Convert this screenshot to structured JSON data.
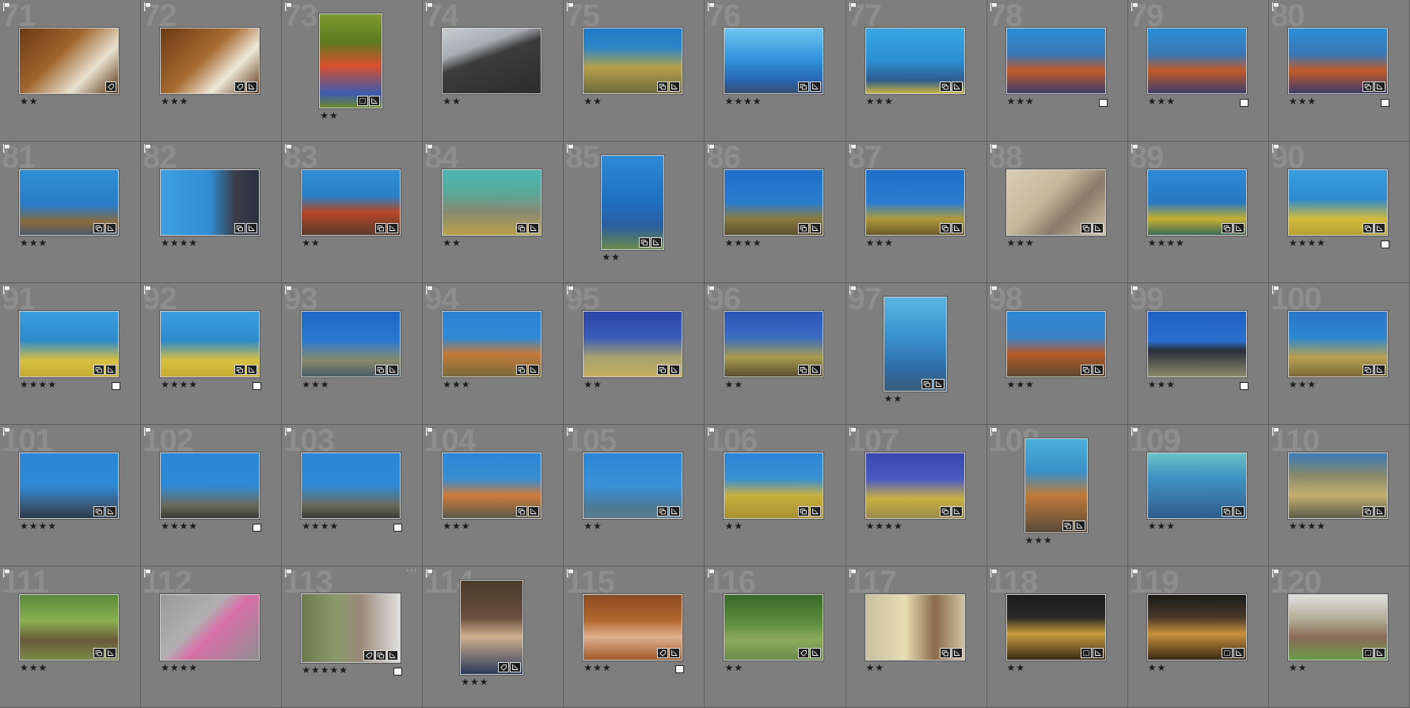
{
  "grid": {
    "cells": [
      {
        "index": "71",
        "stars": "★★",
        "shape": "land",
        "bg": "linear-gradient(135deg,#6b3a14 0%,#a0652d 40%,#e9e2d0 70%,#5a3412 100%)",
        "badges": [
          "keyword-icon"
        ]
      },
      {
        "index": "72",
        "stars": "★★★",
        "shape": "land",
        "bg": "linear-gradient(135deg,#6b3a14 0%,#a86b30 45%,#efe8d8 70%,#5a3412 100%)",
        "badges": [
          "keyword-icon",
          "crop-icon"
        ]
      },
      {
        "index": "73",
        "stars": "★★",
        "shape": "port",
        "bg": "linear-gradient(180deg,#7d9a30 0%,#5d7a20 30%,#d8502c 55%,#3a5bb0 85%,#6b8a2a 100%)",
        "badges": [
          "grid-icon",
          "crop-icon"
        ]
      },
      {
        "index": "74",
        "stars": "★★",
        "shape": "land",
        "bg": "linear-gradient(160deg,#c9cccf 0%,#a9adb1 30%,#3c3c3c 45%,#2c2c2c 100%)",
        "badges": []
      },
      {
        "index": "75",
        "stars": "★★",
        "shape": "land",
        "bg": "linear-gradient(180deg,#1f7ac9 0%,#2d86c4 30%,#b5a14a 60%,#6e6a3d 100%)",
        "badges": [
          "stack-icon",
          "crop-icon"
        ]
      },
      {
        "index": "76",
        "stars": "★★★★",
        "shape": "land",
        "bg": "linear-gradient(180deg,#6cc6f0 0%,#2f8fd8 50%,#2866b0 80%,#3a4e6e 100%)",
        "badges": [
          "stack-icon",
          "crop-icon"
        ]
      },
      {
        "index": "77",
        "stars": "★★★",
        "shape": "land",
        "bg": "linear-gradient(180deg,#38a7e2 0%,#2b8fd3 50%,#2e5b8e 80%,#c8b540 100%)",
        "badges": [
          "stack-icon",
          "crop-icon"
        ]
      },
      {
        "index": "78",
        "stars": "★★★",
        "shape": "land",
        "bg": "linear-gradient(180deg,#2a8ed6 0%,#3a78b5 40%,#c25a28 65%,#3c3c6a 100%)",
        "badges": [],
        "check": true
      },
      {
        "index": "79",
        "stars": "★★★",
        "shape": "land",
        "bg": "linear-gradient(180deg,#2a8ed6 0%,#3a78b5 40%,#c25a28 65%,#3c3c6a 100%)",
        "badges": [],
        "check": true
      },
      {
        "index": "80",
        "stars": "★★★",
        "shape": "land",
        "bg": "linear-gradient(180deg,#2a8ed6 0%,#3a78b5 40%,#c25a28 65%,#3c3c6a 100%)",
        "badges": [
          "stack-icon",
          "crop-icon"
        ],
        "check": true
      },
      {
        "index": "81",
        "stars": "★★★",
        "shape": "land",
        "bg": "linear-gradient(180deg,#2d8fd6 0%,#2a7cc4 55%,#8a6a3a 80%,#4c5a6c 100%)",
        "badges": [
          "stack-icon",
          "crop-icon"
        ]
      },
      {
        "index": "82",
        "stars": "★★★★",
        "shape": "land",
        "bg": "linear-gradient(90deg,#3ea0e0 0%,#2f8cd4 50%,#3a3e48 75%,#2a3040 100%)",
        "badges": [
          "stack-icon",
          "crop-icon"
        ]
      },
      {
        "index": "83",
        "stars": "★★",
        "shape": "land",
        "bg": "linear-gradient(180deg,#2f8fd6 0%,#2a7fc8 40%,#b6472a 65%,#5a3a2a 100%)",
        "badges": [
          "stack-icon",
          "crop-icon"
        ]
      },
      {
        "index": "84",
        "stars": "★★",
        "shape": "land",
        "bg": "linear-gradient(180deg,#49b6b0 0%,#5aa89a 35%,#8a8a72 65%,#b8a24a 100%)",
        "badges": [
          "stack-icon",
          "crop-icon"
        ]
      },
      {
        "index": "85",
        "stars": "★★",
        "shape": "port",
        "bg": "linear-gradient(180deg,#2d8ad6 0%,#1f6fbf 50%,#2a5ea0 75%,#6a8a4a 100%)",
        "badges": [
          "stack-icon",
          "crop-icon"
        ]
      },
      {
        "index": "86",
        "stars": "★★★★",
        "shape": "land",
        "bg": "linear-gradient(180deg,#1f6fc8 0%,#2a7cd0 50%,#8a7a40 75%,#5c5230 100%)",
        "badges": [
          "stack-icon",
          "crop-icon"
        ]
      },
      {
        "index": "87",
        "stars": "★★★",
        "shape": "land",
        "bg": "linear-gradient(180deg,#1f6fc8 0%,#2a7cd0 50%,#b09a3c 75%,#6a5a2a 100%)",
        "badges": [
          "stack-icon",
          "crop-icon"
        ]
      },
      {
        "index": "88",
        "stars": "★★★",
        "shape": "land",
        "bg": "linear-gradient(135deg,#d8cdb5 0%,#c6b89a 40%,#8a7a6a 65%,#d2c5a8 100%)",
        "badges": [
          "stack-icon",
          "crop-icon"
        ]
      },
      {
        "index": "89",
        "stars": "★★★★",
        "shape": "land",
        "bg": "linear-gradient(180deg,#2d8ad6 0%,#2778c2 50%,#c5b030 75%,#3a6a5a 100%)",
        "badges": [
          "stack-icon",
          "crop-icon"
        ]
      },
      {
        "index": "90",
        "stars": "★★★★",
        "shape": "land",
        "bg": "linear-gradient(180deg,#3a9ee0 0%,#2e8ad0 45%,#d2bc3c 75%,#b8a030 100%)",
        "badges": [
          "stack-icon",
          "crop-icon"
        ],
        "check": true
      },
      {
        "index": "91",
        "stars": "★★★★",
        "shape": "land",
        "bg": "linear-gradient(180deg,#3a9ee0 0%,#2f8acb 45%,#d8c040 75%,#c4ac30 100%)",
        "badges": [
          "stack-icon",
          "crop-icon"
        ],
        "check": true
      },
      {
        "index": "92",
        "stars": "★★★★",
        "shape": "land",
        "bg": "linear-gradient(180deg,#3a9ee0 0%,#2f8acb 45%,#d8c040 75%,#c4ac30 100%)",
        "badges": [
          "stack-icon",
          "crop-icon"
        ],
        "check": true
      },
      {
        "index": "93",
        "stars": "★★★",
        "shape": "land",
        "bg": "linear-gradient(180deg,#2066c4 0%,#2a7ad0 45%,#8a8a6a 75%,#4a5c6a 100%)",
        "badges": [
          "stack-icon",
          "crop-icon"
        ]
      },
      {
        "index": "94",
        "stars": "★★★",
        "shape": "land",
        "bg": "linear-gradient(180deg,#2a82d0 0%,#2f8ad6 40%,#c47a3a 65%,#7a6a3a 100%)",
        "badges": [
          "stack-icon",
          "crop-icon"
        ]
      },
      {
        "index": "95",
        "stars": "★★",
        "shape": "land",
        "bg": "linear-gradient(180deg,#2a46a8 0%,#3a5cb8 40%,#a8a070 70%,#c4b060 100%)",
        "badges": [
          "stack-icon",
          "crop-icon"
        ]
      },
      {
        "index": "96",
        "stars": "★★",
        "shape": "land",
        "bg": "linear-gradient(180deg,#2a56b8 0%,#3a6cc0 40%,#a89a50 70%,#5a5030 100%)",
        "badges": [
          "stack-icon",
          "crop-icon"
        ]
      },
      {
        "index": "97",
        "stars": "★★",
        "shape": "port",
        "bg": "linear-gradient(180deg,#5ab6e0 0%,#3a94cf 40%,#2e6ea8 75%,#3a5c7a 100%)",
        "badges": [
          "stack-icon",
          "crop-icon"
        ]
      },
      {
        "index": "98",
        "stars": "★★★",
        "shape": "land",
        "bg": "linear-gradient(180deg,#2a86d2 0%,#3a84c4 40%,#b85a2a 65%,#5a4a30 100%)",
        "badges": [
          "stack-icon",
          "crop-icon"
        ]
      },
      {
        "index": "99",
        "stars": "★★★",
        "shape": "land",
        "bg": "linear-gradient(180deg,#1f5fc4 0%,#2a6fd0 45%,#2a2e3a 60%,#8a8a6a 100%)",
        "badges": [],
        "check": true
      },
      {
        "index": "100",
        "stars": "★★★",
        "shape": "land",
        "bg": "linear-gradient(180deg,#2a76c8 0%,#2e86d0 40%,#b8a050 70%,#7a6a3a 100%)",
        "badges": [
          "stack-icon",
          "crop-icon"
        ]
      },
      {
        "index": "101",
        "stars": "★★★★",
        "shape": "land",
        "bg": "linear-gradient(180deg,#2a86d6 0%,#2f8ad6 50%,#3a5a7a 80%,#2a3a4a 100%)",
        "badges": [
          "stack-icon",
          "crop-icon"
        ]
      },
      {
        "index": "102",
        "stars": "★★★★",
        "shape": "land",
        "bg": "linear-gradient(180deg,#2a86d6 0%,#2f8ad6 50%,#6a6a5a 80%,#3a3a3a 100%)",
        "badges": [],
        "check": true
      },
      {
        "index": "103",
        "stars": "★★★★",
        "shape": "land",
        "bg": "linear-gradient(180deg,#2a86d6 0%,#2f8ad6 50%,#6a6a5a 80%,#3a3a3a 100%)",
        "badges": [],
        "check": true
      },
      {
        "index": "104",
        "stars": "★★★",
        "shape": "land",
        "bg": "linear-gradient(180deg,#2a86d6 0%,#3a8ed0 40%,#d07a3a 65%,#5a5a4a 100%)",
        "badges": [
          "stack-icon",
          "crop-icon"
        ]
      },
      {
        "index": "105",
        "stars": "★★",
        "shape": "land",
        "bg": "linear-gradient(180deg,#2a86d6 0%,#3a90d6 50%,#4a7a9a 80%,#5a7a8a 100%)",
        "badges": [
          "stack-icon",
          "crop-icon"
        ]
      },
      {
        "index": "106",
        "stars": "★★",
        "shape": "land",
        "bg": "linear-gradient(180deg,#2a86d6 0%,#3a90d0 40%,#c8b040 65%,#a89030 100%)",
        "badges": [
          "stack-icon",
          "crop-icon"
        ]
      },
      {
        "index": "107",
        "stars": "★★★★",
        "shape": "land",
        "bg": "linear-gradient(180deg,#3a46b0 0%,#4a5ac0 40%,#c8b040 70%,#9a8a4a 100%)",
        "badges": [
          "stack-icon",
          "crop-icon"
        ]
      },
      {
        "index": "108",
        "stars": "★★★",
        "shape": "port",
        "bg": "linear-gradient(180deg,#4ab0d8 0%,#3a90c8 35%,#c07a3a 60%,#5a4a3a 100%)",
        "badges": [
          "stack-icon",
          "crop-icon"
        ]
      },
      {
        "index": "109",
        "stars": "★★★",
        "shape": "land",
        "bg": "linear-gradient(180deg,#6ac2c8 0%,#3a90c0 40%,#3a78a8 70%,#2a5a8a 100%)",
        "badges": [
          "stack-icon",
          "crop-icon"
        ]
      },
      {
        "index": "110",
        "stars": "★★★★",
        "shape": "land",
        "bg": "linear-gradient(180deg,#3a7ab8 0%,#8a8a6a 35%,#c4b070 65%,#5a5a4a 100%)",
        "badges": [
          "stack-icon",
          "crop-icon"
        ]
      },
      {
        "index": "111",
        "stars": "★★★",
        "shape": "land",
        "bg": "linear-gradient(180deg,#5a8a3a 0%,#8ab050 40%,#6a5a3a 70%,#7a8a4a 100%)",
        "badges": [
          "stack-icon",
          "crop-icon"
        ]
      },
      {
        "index": "112",
        "stars": "★★★★",
        "shape": "land",
        "bg": "linear-gradient(135deg,#9a9a9a 0%,#b0b0b0 40%,#d870a8 55%,#8e8e8e 100%)",
        "badges": []
      },
      {
        "index": "113",
        "stars": "★★★★★",
        "shape": "pano",
        "bg": "linear-gradient(90deg,#6a7a4a 0%,#8a9a6a 35%,#9a8a7a 60%,#e0e0e0 100%)",
        "badges": [
          "keyword-icon",
          "stack-icon",
          "crop-icon"
        ],
        "check": true,
        "more": true
      },
      {
        "index": "114",
        "stars": "★★★",
        "shape": "port",
        "bg": "linear-gradient(180deg,#4a3a2a 0%,#6a5040 40%,#d0b090 60%,#2a3a5a 100%)",
        "badges": [
          "keyword-icon",
          "crop-icon"
        ]
      },
      {
        "index": "115",
        "stars": "★★★",
        "shape": "land",
        "bg": "linear-gradient(180deg,#8a4a20 0%,#b46a30 40%,#e0b090 65%,#a05a2a 100%)",
        "badges": [
          "keyword-icon",
          "crop-icon"
        ],
        "check": true
      },
      {
        "index": "116",
        "stars": "★★",
        "shape": "land",
        "bg": "linear-gradient(180deg,#3a6a2a 0%,#5a8a3a 40%,#8aaa5a 70%,#6a8a4a 100%)",
        "badges": [
          "keyword-icon",
          "crop-icon"
        ]
      },
      {
        "index": "117",
        "stars": "★★",
        "shape": "land",
        "bg": "linear-gradient(90deg,#c8c0a0 0%,#e8dcb0 40%,#8a6a4a 70%,#d0c4a0 100%)",
        "badges": [
          "stack-icon",
          "crop-icon"
        ]
      },
      {
        "index": "118",
        "stars": "★★",
        "shape": "land",
        "bg": "linear-gradient(180deg,#1a1a1a 0%,#2a2a2a 35%,#c89a3a 60%,#3a2a1a 100%)",
        "badges": [
          "grid-icon",
          "crop-icon"
        ]
      },
      {
        "index": "119",
        "stars": "★★",
        "shape": "land",
        "bg": "linear-gradient(180deg,#1a1a1a 0%,#4a3a2a 35%,#c8903a 60%,#3a2a1a 100%)",
        "badges": [
          "grid-icon",
          "crop-icon"
        ]
      },
      {
        "index": "120",
        "stars": "★★",
        "shape": "land",
        "bg": "linear-gradient(180deg,#e0e0e0 0%,#b0a890 40%,#8a6a5a 65%,#6a9a4a 100%)",
        "badges": [
          "grid-icon",
          "crop-icon"
        ]
      }
    ]
  }
}
